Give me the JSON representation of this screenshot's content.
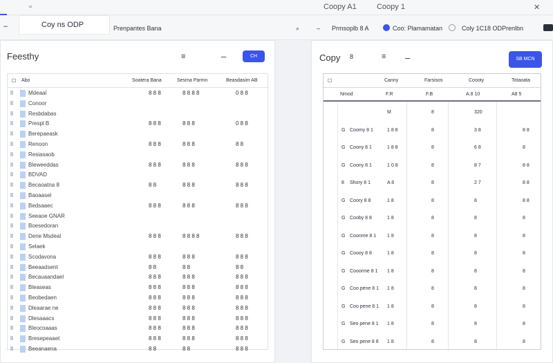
{
  "topbar": {
    "title_1": "Coopy A1",
    "title_2": "Coopy 1"
  },
  "toolbar": {
    "doc_tab": "Coy ns ODP",
    "item_1": "Prenpantes Bana",
    "item_2": "Prmsoplb 8 A",
    "item_3": "Coo: Plamamatan",
    "item_4": "Coly 1C18 OD",
    "item_5": "Prenlbn"
  },
  "left_panel": {
    "title": "Feesthy",
    "button": "CH",
    "headers": [
      "Abo",
      "Soatera Bana",
      "Sesma Parmn",
      "Beasdasim AB"
    ],
    "rows": [
      {
        "name": "Mdeaal",
        "c1": "8 8 8",
        "c2": "8 8 8 8",
        "c3": "0 8 8"
      },
      {
        "name": "Conoor",
        "c1": "",
        "c2": "",
        "c3": ""
      },
      {
        "name": "Resbdabas",
        "c1": "",
        "c2": "",
        "c3": ""
      },
      {
        "name": "Prespl B",
        "c1": "8 8 8",
        "c2": "8 8 8",
        "c3": "0 8 8"
      },
      {
        "name": "Berepaeask",
        "c1": "",
        "c2": "",
        "c3": ""
      },
      {
        "name": "Renoon",
        "c1": "8 8 8",
        "c2": "8 8 8",
        "c3": "8 8"
      },
      {
        "name": "Resiasaob",
        "c1": "",
        "c2": "",
        "c3": ""
      },
      {
        "name": "Bleweeddas",
        "c1": "8 8 8",
        "c2": "8 8 8",
        "c3": "8 8 8"
      },
      {
        "name": "BDVAD",
        "c1": "",
        "c2": "",
        "c3": ""
      },
      {
        "name": "Becaoatna 8",
        "c1": "8 8",
        "c2": "8 8 8",
        "c3": "8 8 8"
      },
      {
        "name": "Baoaasel",
        "c1": "",
        "c2": "",
        "c3": ""
      },
      {
        "name": "Bedsaaec",
        "c1": "8 8 8",
        "c2": "8 8 8",
        "c3": "8 8 8"
      },
      {
        "name": "Seeaoe GNAR",
        "c1": "",
        "c2": "",
        "c3": ""
      },
      {
        "name": "Boesedoran",
        "c1": "",
        "c2": "",
        "c3": ""
      },
      {
        "name": "Dene Msdeal",
        "c1": "8 8 8",
        "c2": "8 8 8 8",
        "c3": "8 8 8"
      },
      {
        "name": "Selaek",
        "c1": "",
        "c2": "",
        "c3": ""
      },
      {
        "name": "Scodavona",
        "c1": "8 8 8",
        "c2": "8 8 8",
        "c3": "8 8 8"
      },
      {
        "name": "Beeaadsent",
        "c1": "8 8",
        "c2": "8 8",
        "c3": "8 8"
      },
      {
        "name": "Becauaandael",
        "c1": "8 8 8",
        "c2": "8 8 8",
        "c3": "8 8 8"
      },
      {
        "name": "Bleaseas",
        "c1": "8 8 8",
        "c2": "8 8 8",
        "c3": "8 8 8"
      },
      {
        "name": "Beobedaen",
        "c1": "8 8 8",
        "c2": "8 8 8",
        "c3": "8 8 8"
      },
      {
        "name": "Dleaarae ne",
        "c1": "8 8 8",
        "c2": "8 8 8",
        "c3": "8 8 8"
      },
      {
        "name": "Dlesaaacs",
        "c1": "8 8 8",
        "c2": "8 8 8",
        "c3": "8 8 8"
      },
      {
        "name": "Bleocoaaas",
        "c1": "8 8 8",
        "c2": "8 8 8",
        "c3": "8 8 8"
      },
      {
        "name": "Bresepeaaet",
        "c1": "8 8 8",
        "c2": "8 8 8",
        "c3": "8 8 8"
      },
      {
        "name": "Beeanaena",
        "c1": "8 8",
        "c2": "8 8",
        "c3": "8 8 8"
      }
    ]
  },
  "right_panel": {
    "title": "Copy",
    "title_tag": "8",
    "button": "SB MCN",
    "headers": [
      "Canny",
      "Farsisos",
      "Coooty",
      "Totaoata"
    ],
    "sub": [
      "Nmod",
      "F.R",
      "F.B",
      "A.8 10",
      "A8 5"
    ],
    "rows": [
      {
        "a": "",
        "name": "",
        "b": "M",
        "c": "8",
        "d": "320",
        "e": ""
      },
      {
        "a": "G",
        "name": "Coomy 8 1",
        "b": "1 8 8",
        "c": "8",
        "d": "3 8",
        "e": "8 8"
      },
      {
        "a": "G",
        "name": "Coony 8 1",
        "b": "1 8 8",
        "c": "8",
        "d": "6 8",
        "e": "8"
      },
      {
        "a": "G",
        "name": "Coony 8 1",
        "b": "1 0 8",
        "c": "8",
        "d": "8 7",
        "e": "8 8"
      },
      {
        "a": "8",
        "name": "Shory 8 1",
        "b": "A 8",
        "c": "8",
        "d": "2 7",
        "e": "8 8"
      },
      {
        "a": "G",
        "name": "Coory 8 8",
        "b": "1 8",
        "c": "8",
        "d": "8",
        "e": "8 8"
      },
      {
        "a": "G",
        "name": "Cooby 8 8",
        "b": "1 8",
        "c": "8",
        "d": "8",
        "e": "8"
      },
      {
        "a": "G",
        "name": "Coonme 8 1",
        "b": "1 8",
        "c": "8",
        "d": "8",
        "e": "8"
      },
      {
        "a": "G",
        "name": "Coooy 8 8",
        "b": "1 8",
        "c": "8",
        "d": "8",
        "e": "8"
      },
      {
        "a": "G",
        "name": "Cooorme 8 1",
        "b": "1 8",
        "c": "8",
        "d": "8",
        "e": "8"
      },
      {
        "a": "G",
        "name": "Coo pene 8 1",
        "b": "1 8",
        "c": "8",
        "d": "8",
        "e": "8"
      },
      {
        "a": "G",
        "name": "Coo pene 8 1",
        "b": "1 8",
        "c": "8",
        "d": "8",
        "e": "8"
      },
      {
        "a": "G",
        "name": "Seo pene 8 1",
        "b": "1 8",
        "c": "8",
        "d": "8",
        "e": "8"
      },
      {
        "a": "G",
        "name": "Seo pene 8 8",
        "b": "1 8",
        "c": "8",
        "d": "8",
        "e": "8"
      }
    ]
  }
}
